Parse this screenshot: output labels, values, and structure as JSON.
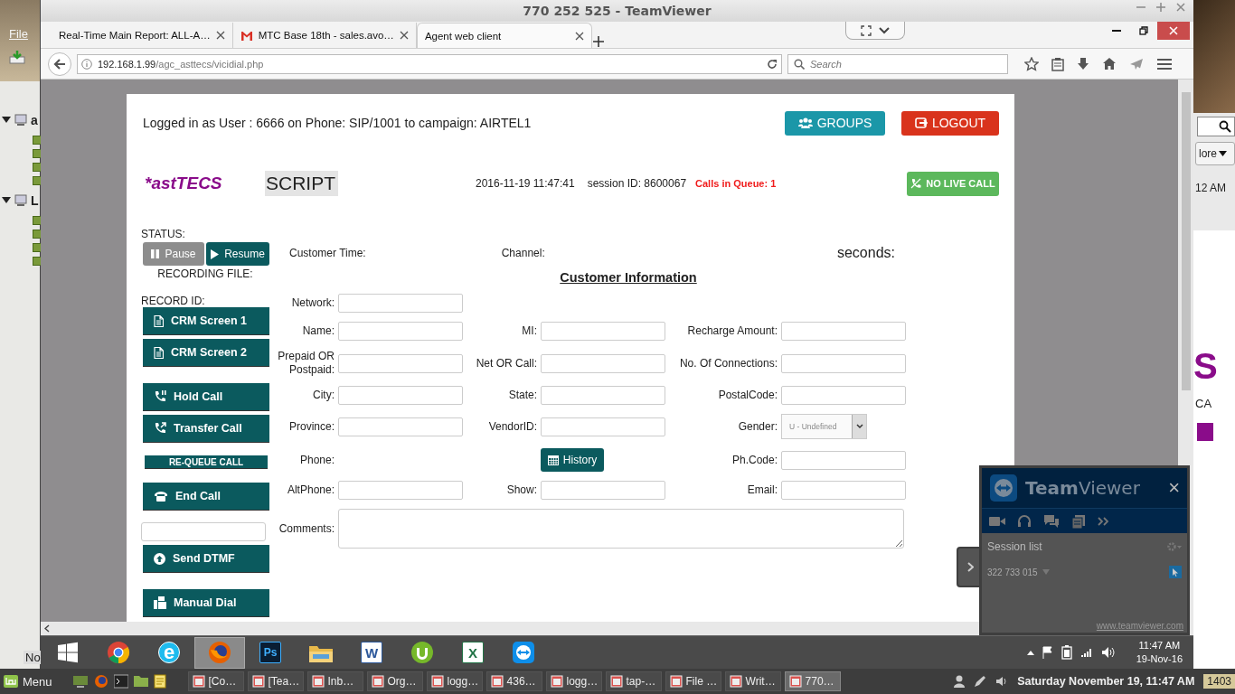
{
  "desktop_left": {
    "menu": "File",
    "tree_items": [
      {
        "label": "a",
        "expanded": true
      },
      {
        "label": "L",
        "expanded": true
      }
    ],
    "status_text": "No"
  },
  "desktop_right": {
    "more_button": "lore",
    "time": "12 AM",
    "heading_fragment": "S",
    "text_fragment": "CA"
  },
  "teamviewer_window": {
    "title": "770 252 525 - TeamViewer"
  },
  "browser": {
    "tabs": [
      {
        "label": "Real-Time Main Report: ALL-A…",
        "selected": false,
        "kind": "plain"
      },
      {
        "label": "MTC Base 18th - sales.avo…",
        "selected": false,
        "kind": "mail"
      },
      {
        "label": "Agent web client",
        "selected": true,
        "kind": "plain"
      }
    ],
    "url_host": "192.168.1.99",
    "url_path": "/agc_asttecs/vicidial.php",
    "search": {
      "placeholder": "Search"
    }
  },
  "agent": {
    "login_info": "Logged in as User : 6666 on Phone: SIP/1001  to campaign: AIRTEL1",
    "groups_button": "GROUPS",
    "logout_button": "LOGOUT",
    "logo": "*astTECS",
    "script_tab": "SCRIPT",
    "datetime": "2016-11-19 11:47:41",
    "session": "session ID: 8600067",
    "queue": "Calls in Queue: 1",
    "live_call_button": "NO LIVE CALL",
    "status_label": "STATUS:",
    "pause": {
      "label": "Pause",
      "disabled": true
    },
    "resume": {
      "label": "Resume",
      "disabled": false
    },
    "recording_file": "RECORDING FILE:",
    "record_id": "RECORD ID:",
    "side_controls": [
      {
        "kind": "document",
        "label": "CRM Screen 1"
      },
      {
        "kind": "document",
        "label": "CRM Screen 2"
      },
      {
        "kind": "hold",
        "label": "Hold Call"
      },
      {
        "kind": "transfer",
        "label": "Transfer Call"
      },
      {
        "kind": "small",
        "label": "RE-QUEUE CALL"
      },
      {
        "kind": "phone",
        "label": "End Call"
      },
      {
        "kind": "field"
      },
      {
        "kind": "upload",
        "label": "Send DTMF"
      },
      {
        "kind": "dial",
        "label": "Manual Dial"
      }
    ],
    "customer_time": "Customer Time:",
    "channel": "Channel:",
    "seconds": "seconds:",
    "section_title": "Customer Information",
    "form_rows": [
      {
        "left": {
          "label": "Network:",
          "kind": "input"
        }
      },
      {
        "left": {
          "label": "Name:",
          "kind": "input"
        },
        "middle": {
          "label": "MI:",
          "kind": "input"
        },
        "right": {
          "label": "Recharge Amount:",
          "kind": "input"
        }
      },
      {
        "left": {
          "label": "Prepaid OR Postpaid:",
          "kind": "input"
        },
        "middle": {
          "label": "Net OR Call:",
          "kind": "input"
        },
        "right": {
          "label": "No. Of Connections:",
          "kind": "input"
        }
      },
      {
        "left": {
          "label": "City:",
          "kind": "input"
        },
        "middle": {
          "label": "State:",
          "kind": "input"
        },
        "right": {
          "label": "PostalCode:",
          "kind": "input"
        }
      },
      {
        "left": {
          "label": "Province:",
          "kind": "input"
        },
        "middle": {
          "label": "VendorID:",
          "kind": "input"
        },
        "right": {
          "label": "Gender:",
          "kind": "select",
          "value": "U - Undefined"
        }
      },
      {
        "left": {
          "label": "Phone:",
          "kind": "label_only"
        },
        "middle": {
          "kind": "button",
          "button": "History"
        },
        "right": {
          "label": "Ph.Code:",
          "kind": "input"
        }
      },
      {
        "left": {
          "label": "AltPhone:",
          "kind": "input"
        },
        "middle": {
          "label": "Show:",
          "kind": "input"
        },
        "right": {
          "label": "Email:",
          "kind": "input"
        }
      }
    ],
    "comments_label": "Comments:"
  },
  "windows_taskbar": {
    "apps": [
      {
        "kind": "start",
        "selected": false
      },
      {
        "kind": "chrome",
        "selected": false
      },
      {
        "kind": "ie",
        "label": "e",
        "selected": false
      },
      {
        "kind": "firefox",
        "selected": true
      },
      {
        "kind": "photoshop",
        "label": "Ps",
        "selected": false
      },
      {
        "kind": "explorer",
        "selected": false
      },
      {
        "kind": "word",
        "label": "W",
        "selected": false
      },
      {
        "kind": "utorrent",
        "selected": false
      },
      {
        "kind": "excel",
        "label": "X",
        "selected": false
      },
      {
        "kind": "teamviewer",
        "selected": false
      }
    ],
    "time": "11:47 AM",
    "date": "19-Nov-16"
  },
  "teamviewer_panel": {
    "title": "**Team**Viewer",
    "close": "×",
    "section": "Session list",
    "session_id": "322 733 015",
    "link": "www.teamviewer.com"
  },
  "linux_panel": {
    "menu": "Menu",
    "tasks": [
      {
        "label": "[Co…",
        "selected": false
      },
      {
        "label": "[Tea…",
        "selected": false
      },
      {
        "label": "Inb…",
        "selected": false
      },
      {
        "label": "Org…",
        "selected": false
      },
      {
        "label": "logg…",
        "selected": false
      },
      {
        "label": "436…",
        "selected": false
      },
      {
        "label": "logg…",
        "selected": false
      },
      {
        "label": "tap-…",
        "selected": false
      },
      {
        "label": "File …",
        "selected": false
      },
      {
        "label": "Writ…",
        "selected": false
      },
      {
        "label": "770…",
        "selected": true
      }
    ],
    "clock": "Saturday November 19, 11:47 AM",
    "counter": "1403"
  }
}
